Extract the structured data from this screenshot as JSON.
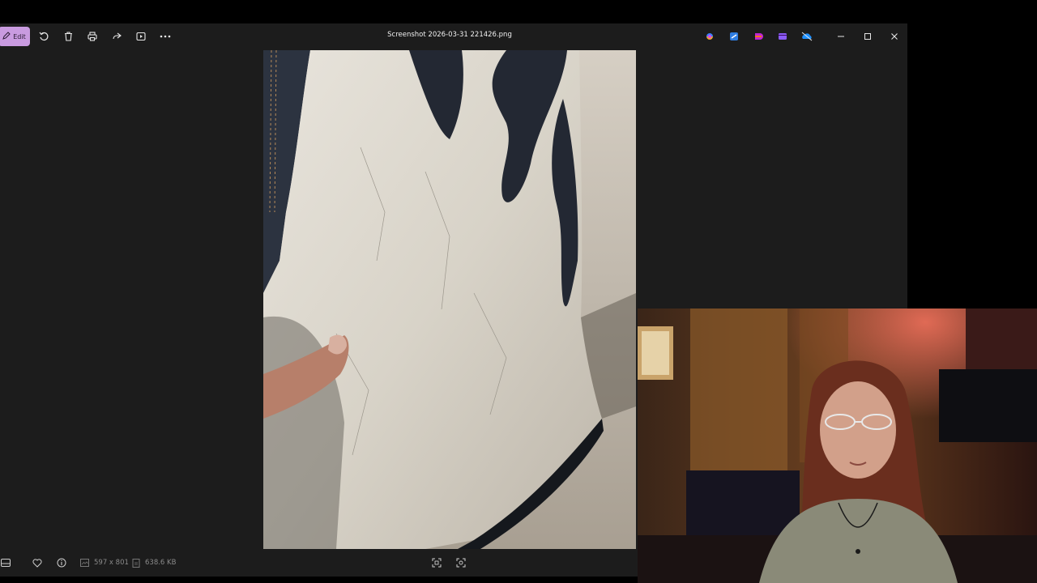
{
  "toolbar": {
    "edit_label": "Edit",
    "file_title": "Screenshot 2026-03-31 221426.png"
  },
  "status": {
    "dimensions": "597 x 801",
    "file_size": "638.6 KB"
  },
  "colors": {
    "viewer_bg": "#1c1c1c",
    "edit_accent": "#c99be0"
  },
  "icons": {
    "toolbar": [
      "rotate-icon",
      "delete-icon",
      "print-icon",
      "share-icon",
      "slideshow-icon",
      "more-icon"
    ],
    "apps": [
      "copilot-icon",
      "clipchamp-icon",
      "designer-icon",
      "video-editor-icon",
      "onedrive-icon"
    ],
    "window": [
      "minimize-icon",
      "maximize-icon",
      "close-icon"
    ],
    "status": [
      "filmstrip-icon",
      "favorite-icon",
      "info-icon",
      "zoom-fit-icon",
      "zoom-actual-icon"
    ]
  }
}
